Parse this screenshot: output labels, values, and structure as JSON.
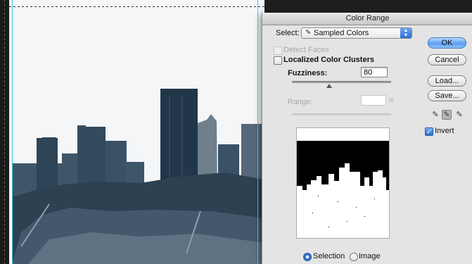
{
  "dialog": {
    "title": "Color Range",
    "select": {
      "label": "Select:",
      "value": "Sampled Colors",
      "icon": "eyedropper-icon"
    },
    "detect_faces": {
      "label": "Detect Faces",
      "checked": false,
      "enabled": false
    },
    "localized_clusters": {
      "label": "Localized Color Clusters",
      "checked": false
    },
    "fuzziness": {
      "label": "Fuzziness:",
      "value": "80"
    },
    "range": {
      "label": "Range:",
      "value": "",
      "unit": "%",
      "enabled": false
    },
    "view": {
      "selection_label": "Selection",
      "image_label": "Image",
      "selected": "Selection"
    },
    "buttons": {
      "ok": "OK",
      "cancel": "Cancel",
      "load": "Load...",
      "save": "Save..."
    },
    "droppers": [
      "eyedropper-icon",
      "eyedropper-plus-icon",
      "eyedropper-minus-icon"
    ],
    "invert": {
      "label": "Invert",
      "checked": true
    }
  },
  "colors": {
    "ok_button_accent": "#5d9ff0",
    "guide": "#41c9e2",
    "skyline": "#344a5c",
    "mask_black": "#000000"
  }
}
